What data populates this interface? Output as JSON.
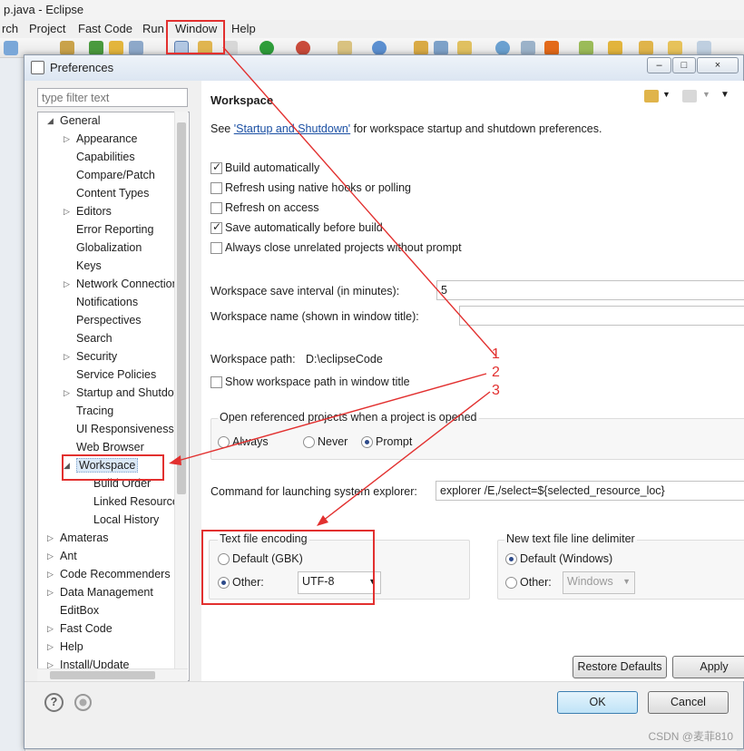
{
  "window_title": "p.java - Eclipse",
  "menu": [
    "rch",
    "Project",
    "Fast Code",
    "Run",
    "Window",
    "Help"
  ],
  "dialog": {
    "title": "Preferences",
    "filter_placeholder": "type filter text",
    "win_buttons": [
      "–",
      "□",
      "×"
    ]
  },
  "tree": [
    {
      "label": "General",
      "arrow": "down"
    },
    {
      "label": "Appearance",
      "arrow": "right"
    },
    {
      "label": "Capabilities",
      "arrow": ""
    },
    {
      "label": "Compare/Patch",
      "arrow": ""
    },
    {
      "label": "Content Types",
      "arrow": ""
    },
    {
      "label": "Editors",
      "arrow": "right"
    },
    {
      "label": "Error Reporting",
      "arrow": ""
    },
    {
      "label": "Globalization",
      "arrow": ""
    },
    {
      "label": "Keys",
      "arrow": ""
    },
    {
      "label": "Network Connections",
      "arrow": "right"
    },
    {
      "label": "Notifications",
      "arrow": ""
    },
    {
      "label": "Perspectives",
      "arrow": ""
    },
    {
      "label": "Search",
      "arrow": ""
    },
    {
      "label": "Security",
      "arrow": "right"
    },
    {
      "label": "Service Policies",
      "arrow": ""
    },
    {
      "label": "Startup and Shutdown",
      "arrow": "right"
    },
    {
      "label": "Tracing",
      "arrow": ""
    },
    {
      "label": "UI Responsiveness",
      "arrow": ""
    },
    {
      "label": "Web Browser",
      "arrow": ""
    },
    {
      "label": "Workspace",
      "arrow": "down",
      "selected": true
    },
    {
      "label": "Build Order",
      "arrow": ""
    },
    {
      "label": "Linked Resources",
      "arrow": ""
    },
    {
      "label": "Local History",
      "arrow": ""
    },
    {
      "label": "Amateras",
      "arrow": "right"
    },
    {
      "label": "Ant",
      "arrow": "right"
    },
    {
      "label": "Code Recommenders",
      "arrow": "right"
    },
    {
      "label": "Data Management",
      "arrow": "right"
    },
    {
      "label": "EditBox",
      "arrow": ""
    },
    {
      "label": "Fast Code",
      "arrow": "right"
    },
    {
      "label": "Help",
      "arrow": "right"
    },
    {
      "label": "Install/Update",
      "arrow": "right"
    }
  ],
  "page": {
    "title": "Workspace",
    "intro_before": "See ",
    "intro_link": "'Startup and Shutdown'",
    "intro_after": " for workspace startup and shutdown preferences.",
    "checks": [
      {
        "label": "Build automatically",
        "checked": true
      },
      {
        "label": "Refresh using native hooks or polling",
        "checked": false
      },
      {
        "label": "Refresh on access",
        "checked": false
      },
      {
        "label": "Save automatically before build",
        "checked": true
      },
      {
        "label": "Always close unrelated projects without prompt",
        "checked": false
      }
    ],
    "save_interval_label": "Workspace save interval (in minutes):",
    "save_interval_value": "5",
    "ws_name_label": "Workspace name (shown in window title):",
    "ws_name_value": "",
    "ws_path_label": "Workspace path:",
    "ws_path_value": "D:\\eclipseCode",
    "show_path_label": "Show workspace path in window title",
    "open_projects": {
      "label": "Open referenced projects when a project is opened",
      "options": [
        {
          "label": "Always",
          "checked": false
        },
        {
          "label": "Never",
          "checked": false
        },
        {
          "label": "Prompt",
          "checked": true
        }
      ]
    },
    "explorer_label": "Command for launching system explorer:",
    "explorer_value": "explorer /E,/select=${selected_resource_loc}",
    "encoding": {
      "label": "Text file encoding",
      "default_label": "Default (GBK)",
      "other_label": "Other:",
      "other_checked": true,
      "value": "UTF-8"
    },
    "delimiter": {
      "label": "New text file line delimiter",
      "default_label": "Default (Windows)",
      "other_label": "Other:",
      "default_checked": true,
      "value": "Windows"
    },
    "restore_defaults": "Restore Defaults",
    "apply": "Apply"
  },
  "buttons": {
    "ok": "OK",
    "cancel": "Cancel"
  },
  "annotations": [
    "1",
    "2",
    "3"
  ],
  "annotation_color": "#e2302f",
  "watermark": "CSDN @麦菲810"
}
